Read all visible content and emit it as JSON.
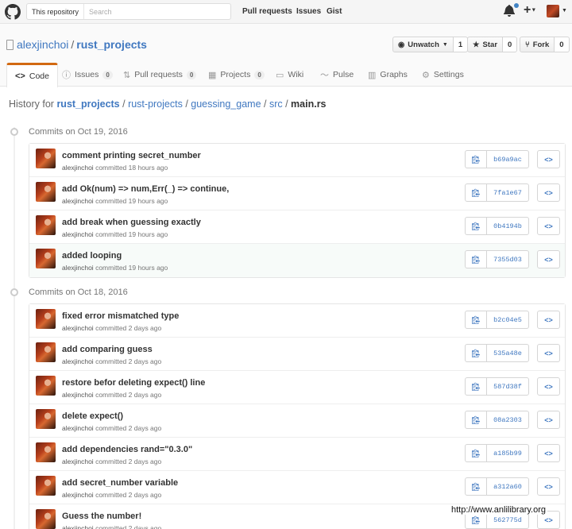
{
  "header": {
    "search_scope": "This repository",
    "search_placeholder": "Search",
    "nav": [
      "Pull requests",
      "Issues",
      "Gist"
    ],
    "plus_label": "+"
  },
  "repo": {
    "owner": "alexjinchoi",
    "separator": "/",
    "name": "rust_projects",
    "watch_label": "Unwatch",
    "watch_count": "1",
    "star_label": "Star",
    "star_count": "0",
    "fork_label": "Fork",
    "fork_count": "0"
  },
  "tabs": [
    {
      "label": "Code",
      "count": null,
      "icon": "code-icon"
    },
    {
      "label": "Issues",
      "count": "0",
      "icon": "issue-icon"
    },
    {
      "label": "Pull requests",
      "count": "0",
      "icon": "pull-request-icon"
    },
    {
      "label": "Projects",
      "count": "0",
      "icon": "project-icon"
    },
    {
      "label": "Wiki",
      "count": null,
      "icon": "book-icon"
    },
    {
      "label": "Pulse",
      "count": null,
      "icon": "pulse-icon"
    },
    {
      "label": "Graphs",
      "count": null,
      "icon": "graph-icon"
    },
    {
      "label": "Settings",
      "count": null,
      "icon": "gear-icon"
    }
  ],
  "breadcrumb": {
    "prefix": "History for",
    "parts": [
      "rust_projects",
      "rust-projects",
      "guessing_game",
      "src"
    ],
    "file": "main.rs"
  },
  "groups": [
    {
      "title": "Commits on Oct 19, 2016",
      "commits": [
        {
          "message": "comment printing secret_number",
          "author": "alexjinchoi",
          "time": "committed 18 hours ago",
          "sha": "b69a9ac"
        },
        {
          "message": "add Ok(num) => num,Err(_) => continue,",
          "author": "alexjinchoi",
          "time": "committed 19 hours ago",
          "sha": "7fa1e67"
        },
        {
          "message": "add break when guessing exactly",
          "author": "alexjinchoi",
          "time": "committed 19 hours ago",
          "sha": "0b4194b"
        },
        {
          "message": "added looping",
          "author": "alexjinchoi",
          "time": "committed 19 hours ago",
          "sha": "7355d03"
        }
      ]
    },
    {
      "title": "Commits on Oct 18, 2016",
      "commits": [
        {
          "message": "fixed error mismatched type",
          "author": "alexjinchoi",
          "time": "committed 2 days ago",
          "sha": "b2c04e5"
        },
        {
          "message": "add comparing guess",
          "author": "alexjinchoi",
          "time": "committed 2 days ago",
          "sha": "535a48e"
        },
        {
          "message": "restore befor deleting expect() line",
          "author": "alexjinchoi",
          "time": "committed 2 days ago",
          "sha": "587d38f"
        },
        {
          "message": "delete expect()",
          "author": "alexjinchoi",
          "time": "committed 2 days ago",
          "sha": "08a2303"
        },
        {
          "message": "add dependencies rand=\"0.3.0\"",
          "author": "alexjinchoi",
          "time": "committed 2 days ago",
          "sha": "a185b99"
        },
        {
          "message": "add secret_number variable",
          "author": "alexjinchoi",
          "time": "committed 2 days ago",
          "sha": "a312a60"
        },
        {
          "message": "Guess the number!",
          "author": "alexjinchoi",
          "time": "committed 2 days ago",
          "sha": "562775d"
        }
      ]
    }
  ],
  "browse_label": "<>",
  "watermark": "http://www.anlilibrary.org",
  "colors": {
    "link": "#4078c0",
    "tab_accent": "#d26911",
    "highlight_row": "#f7fbf9"
  }
}
